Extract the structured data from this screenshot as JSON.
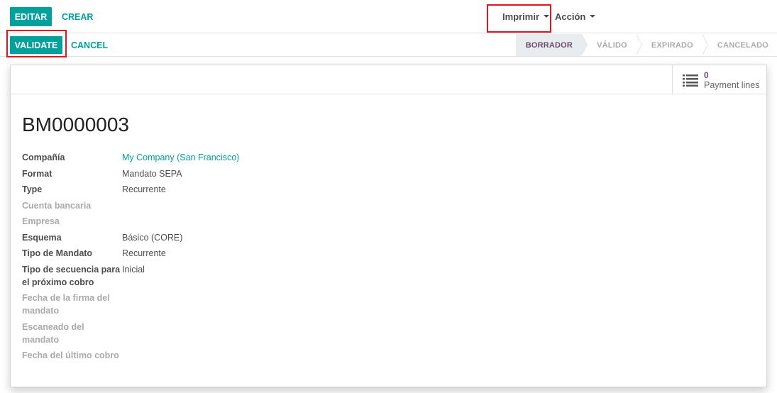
{
  "control_panel": {
    "edit_label": "EDITAR",
    "create_label": "CREAR",
    "print_label": "Imprimir",
    "action_label": "Acción",
    "validate_label": "VALIDATE",
    "cancel_label": "CANCEL"
  },
  "statusbar": {
    "steps": [
      {
        "label": "BORRADOR",
        "active": true
      },
      {
        "label": "VÁLIDO",
        "active": false
      },
      {
        "label": "EXPIRADO",
        "active": false
      },
      {
        "label": "CANCELADO",
        "active": false
      }
    ]
  },
  "smart_button": {
    "icon": "list-icon",
    "count": "0",
    "label": "Payment lines"
  },
  "record": {
    "title": "BM0000003",
    "fields": [
      {
        "label": "Compañía",
        "value": "My Company (San Francisco)",
        "muted": false,
        "link": true
      },
      {
        "label": "Format",
        "value": "Mandato SEPA",
        "muted": false
      },
      {
        "label": "Type",
        "value": "Recurrente",
        "muted": false
      },
      {
        "label": "Cuenta bancaria",
        "value": "",
        "muted": true
      },
      {
        "label": "Empresa",
        "value": "",
        "muted": true
      },
      {
        "label": "Esquema",
        "value": "Básico (CORE)",
        "muted": false
      },
      {
        "label": "Tipo de Mandato",
        "value": "Recurrente",
        "muted": false
      },
      {
        "label": "Tipo de secuencia para el próximo cobro",
        "value": "Inicial",
        "muted": false
      },
      {
        "label": "Fecha de la firma del mandato",
        "value": "",
        "muted": true
      },
      {
        "label": "Escaneado del mandato",
        "value": "",
        "muted": true
      },
      {
        "label": "Fecha del último cobro",
        "value": "",
        "muted": true
      }
    ]
  },
  "colors": {
    "primary": "#00a09d",
    "highlight": "#e3141d",
    "status_active": "#6b4a6b"
  }
}
